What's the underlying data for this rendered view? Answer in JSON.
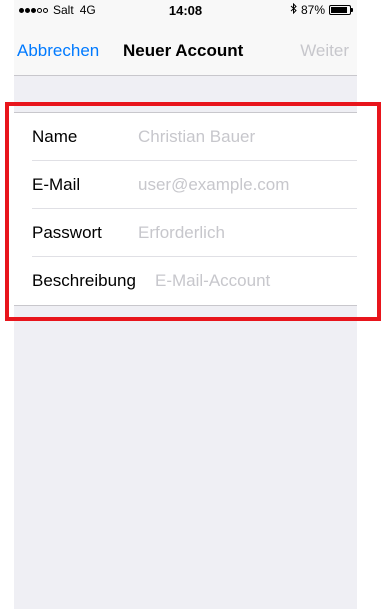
{
  "status_bar": {
    "carrier": "Salt",
    "network": "4G",
    "time": "14:08",
    "battery_percent": "87%",
    "battery_level": 0.87,
    "signal_bars_filled": 3,
    "signal_bars_total": 5
  },
  "nav": {
    "cancel_label": "Abbrechen",
    "title": "Neuer Account",
    "next_label": "Weiter"
  },
  "form": {
    "fields": [
      {
        "label": "Name",
        "placeholder": "Christian Bauer",
        "value": ""
      },
      {
        "label": "E-Mail",
        "placeholder": "user@example.com",
        "value": ""
      },
      {
        "label": "Passwort",
        "placeholder": "Erforderlich",
        "value": ""
      },
      {
        "label": "Beschreibung",
        "placeholder": "E-Mail-Account",
        "value": ""
      }
    ]
  },
  "colors": {
    "accent": "#007aff",
    "disabled": "#c7c7cc",
    "highlight": "#e8151c",
    "background": "#efeff4"
  },
  "icons": {
    "bluetooth": "bluetooth-icon",
    "battery": "battery-icon",
    "signal": "signal-dots-icon"
  }
}
